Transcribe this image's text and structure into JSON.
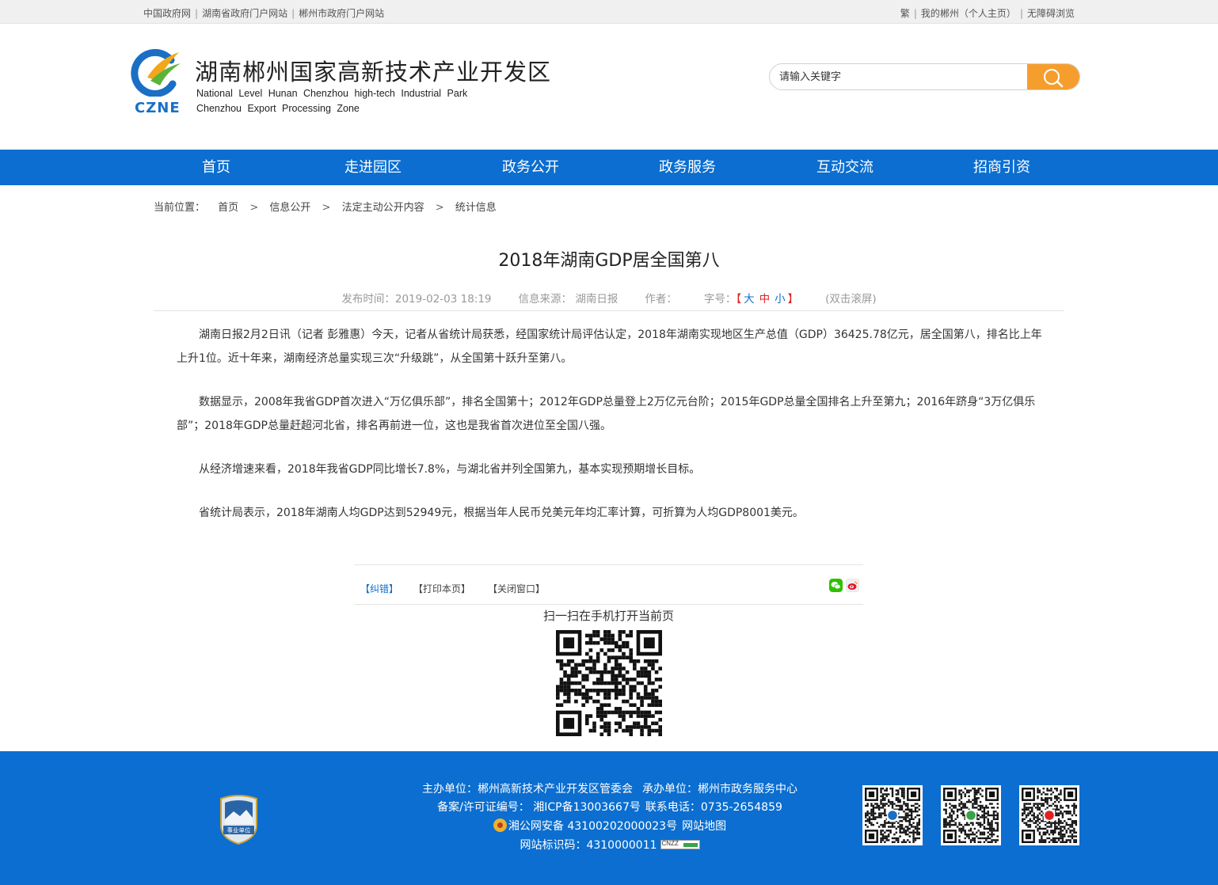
{
  "topbar": {
    "left_links": [
      "中国政府网",
      "湖南省政府门户网站",
      "郴州市政府门户网站"
    ],
    "right_links": [
      "繁",
      "我的郴州（个人主页）",
      "无障碍浏览"
    ]
  },
  "header": {
    "logo_text": "CZNE",
    "title": "湖南郴州国家高新技术产业开发区",
    "en_line1": "National Level Hunan Chenzhou high-tech Industrial Park",
    "en_line2": "Chenzhou Export Processing Zone",
    "search_placeholder": "请输入关键字",
    "search_color": "#f59e2e"
  },
  "nav": {
    "color": "#0b6ed0",
    "items": [
      "首页",
      "走进园区",
      "政务公开",
      "政务服务",
      "互动交流",
      "招商引资"
    ]
  },
  "breadcrumb": {
    "lead": "当前位置：",
    "items": [
      "首页",
      "信息公开",
      "法定主动公开内容",
      "统计信息"
    ],
    "arrow": ">"
  },
  "article": {
    "title": "2018年湖南GDP居全国第八",
    "publish": "发布时间：2019-02-03 18:19",
    "source": "信息来源：  湖南日报",
    "author": "作者：",
    "font_label": "字号：",
    "bracket_open": "【",
    "font_large": "大",
    "font_mid": "中",
    "font_small": "小",
    "bracket_close": "】",
    "scroll": "(双击滚屏)",
    "paragraphs": [
      "湖南日报2月2日讯（记者 彭雅惠）今天，记者从省统计局获悉，经国家统计局评估认定，2018年湖南实现地区生产总值（GDP）36425.78亿元，居全国第八，排名比上年上升1位。近十年来，湖南经济总量实现三次“升级跳”，从全国第十跃升至第八。",
      "数据显示，2008年我省GDP首次进入“万亿俱乐部”，排名全国第十；2012年GDP总量登上2万亿元台阶；2015年GDP总量全国排名上升至第九；2016年跻身“3万亿俱乐部”；2018年GDP总量赶超河北省，排名再前进一位，这也是我省首次进位至全国八强。",
      "从经济增速来看，2018年我省GDP同比增长7.8%，与湖北省并列全国第九，基本实现预期增长目标。",
      "省统计局表示，2018年湖南人均GDP达到52949元，根据当年人民币兑美元年均汇率计算，可折算为人均GDP8001美元。"
    ]
  },
  "tools": {
    "correct": "【纠错】",
    "print": "【打印本页】",
    "close": "【关闭窗口】",
    "qr_caption": "扫一扫在手机打开当前页"
  },
  "footer": {
    "badge_text": "事业单位",
    "host": "主办单位：郴州高新技术产业开发区管委会",
    "undertaker": "承办单位：郴州市政务服务中心",
    "icp": "备案/许可证编号： 湘ICP备13003667号",
    "phone": "联系电话：0735-2654859",
    "police": "湘公网安备 43100202000023号",
    "sitemap": "网站地图",
    "site_id": "网站标识码：4310000011"
  }
}
